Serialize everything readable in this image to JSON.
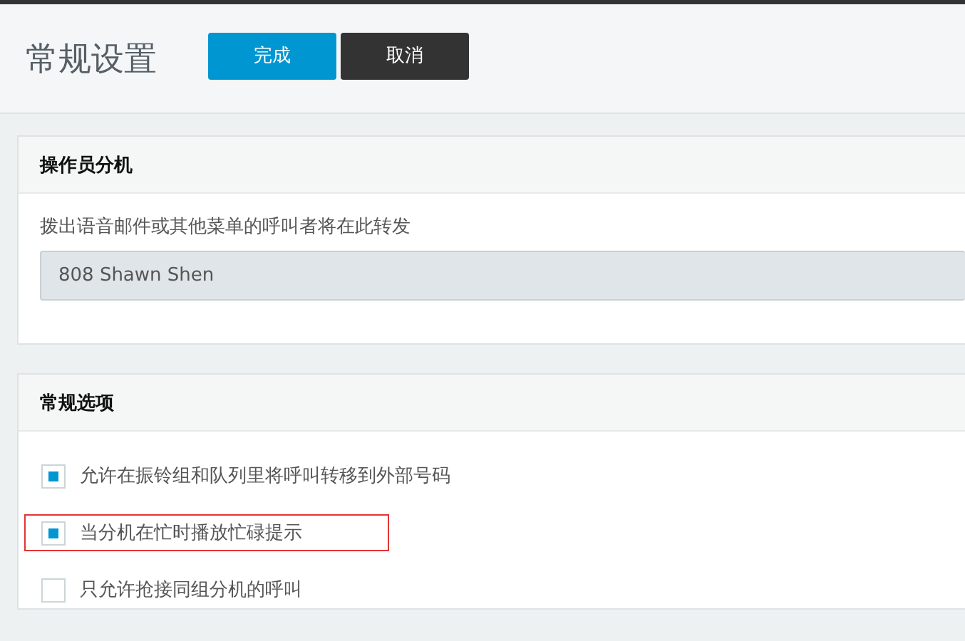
{
  "header": {
    "title": "常规设置",
    "buttons": [
      {
        "label": "完成",
        "kind": "primary"
      },
      {
        "label": "取消",
        "kind": "secondary"
      }
    ]
  },
  "operator_panel": {
    "title": "操作员分机",
    "description": "拨出语音邮件或其他菜单的呼叫者将在此转发",
    "select_value": "808 Shawn Shen"
  },
  "options_panel": {
    "title": "常规选项",
    "options": [
      {
        "label": "允许在振铃组和队列里将呼叫转移到外部号码",
        "checked": true,
        "highlighted": false
      },
      {
        "label": "当分机在忙时播放忙碌提示",
        "checked": true,
        "highlighted": true
      },
      {
        "label": "只允许抢接同组分机的呼叫",
        "checked": false,
        "highlighted": false
      }
    ]
  }
}
